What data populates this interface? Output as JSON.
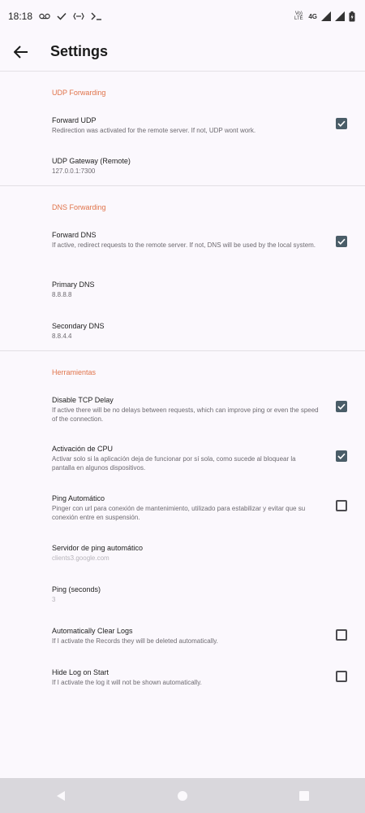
{
  "status_bar": {
    "time": "18:18",
    "volte": "Vo) LTE",
    "network_type": "4G",
    "icons": [
      "voicemail-icon",
      "check-icon",
      "vpn-key-icon",
      "terminal-icon",
      "signal-icon",
      "signal-icon",
      "battery-icon"
    ]
  },
  "app_bar": {
    "title": "Settings",
    "back_icon": "arrow-left-icon"
  },
  "sections": {
    "udp": {
      "header": "UDP Forwarding",
      "forward_udp": {
        "title": "Forward UDP",
        "summary": "Redirection was activated for the remote server. If not, UDP wont work.",
        "checked": true
      },
      "udp_gateway": {
        "title": "UDP Gateway (Remote)",
        "summary": "127.0.0.1:7300"
      }
    },
    "dns": {
      "header": "DNS Forwarding",
      "forward_dns": {
        "title": "Forward DNS",
        "summary": "If active, redirect requests to the remote server. If not, DNS will be used by the local system.",
        "checked": true
      },
      "primary_dns": {
        "title": "Primary DNS",
        "summary": "8.8.8.8"
      },
      "secondary_dns": {
        "title": "Secondary DNS",
        "summary": "8.8.4.4"
      }
    },
    "tools": {
      "header": "Herramientas",
      "tcp_delay": {
        "title": "Disable TCP Delay",
        "summary": "If active there will be no delays between requests, which can improve ping or even the speed of the connection.",
        "checked": true
      },
      "cpu": {
        "title": "Activación de CPU",
        "summary": "Activar solo si la aplicación deja de funcionar por sí sola, como sucede al bloquear la pantalla en algunos dispositivos.",
        "checked": true
      },
      "auto_ping": {
        "title": "Ping Automático",
        "summary": "Pinger con url para conexión de mantenimiento, utilizado para estabilizar y evitar que su conexión entre en suspensión.",
        "checked": false
      },
      "ping_server": {
        "title": "Servidor de ping automático",
        "summary": "clients3.google.com"
      },
      "ping_seconds": {
        "title": "Ping (seconds)",
        "summary": "3"
      },
      "clear_logs": {
        "title": "Automatically Clear Logs",
        "summary": "If I activate the Records they will be deleted automatically.",
        "checked": false
      },
      "hide_log": {
        "title": "Hide Log on Start",
        "summary": "If I activate the log it will not be shown automatically.",
        "checked": false
      }
    }
  },
  "nav_bar": {
    "buttons": [
      "back-triangle-icon",
      "home-circle-icon",
      "recents-square-icon"
    ]
  },
  "colors": {
    "accent": "#e0734a",
    "checkbox": "#4a5d68",
    "background": "#fbf8fd",
    "nav_bar": "#d9d7dc"
  }
}
